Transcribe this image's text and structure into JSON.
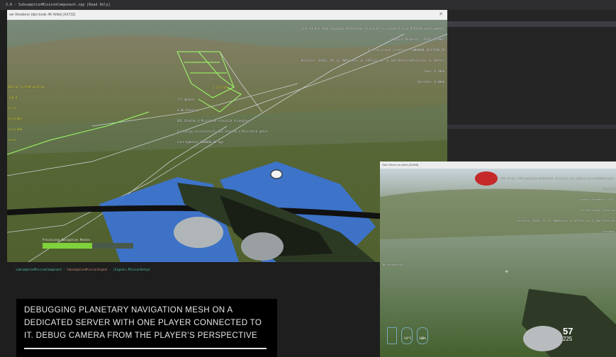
{
  "ide": {
    "title": "2.0 - SubsumptionMissionComponent.cpp [Read Only]",
    "code_line": {
      "a": "subsumptionMissionComponent",
      "b": "SubsumptionMissionSignal",
      "c": "(Signals.MissionSetup)"
    }
  },
  "server_window": {
    "title": "ver Renderer (dpi mode 4K-Wide) [43732]",
    "close_label": "✕",
    "hud_top_right": [
      "Cont AI Dev 7VA4 enginmap PU(Stanton (9.0.0.0) [sc-alpha-3.23.0.9553610 development]",
      "Graphics Renderer : DX11 (7598A)",
      "Current player location : UNKNOWN_LOCATION_ID",
      "Entities: 45656, PS: 0, DWPatches: 0, DFPixelize: 0, Net-DeferredPixelize: 0, Deferr",
      "Zone: 0.20mb",
      "Chardata: 0.00mb"
    ],
    "hud_left": [
      "Nation System working",
      "ing 0",
      "nn 0",
      "ed 0.0ms",
      "ng 0.00%",
      "ed 0"
    ],
    "hud_center_title": "1 Inflate",
    "hud_center": [
      "Tri Update",
      "0.00 Pending",
      "ODC_Stanton_4_Microtech->Invalid triangles",
      "Colliding vicinities(1) ODC_Stanton_4 Microtech patch",
      "Last Updated 1000000.00 ago"
    ],
    "progress_label": "Processing Navigation Meshes",
    "progress_fraction": 0.55
  },
  "client_window": {
    "title": "Star Citizen sc-client [32968]",
    "hud_top_right": [
      "PTS 42-Dev 7VA4 enginmap PU(Stanton (9.0.0.0) [sc-alpha-3.23.0.9553610 devel",
      "FPS 36.8",
      "Graphics Renderer : DX11",
      "Current player location",
      "Entities: 45654, PS: 0, DWPatches: 0, DFPixelize: 0, Net-Deferred",
      "Chardata"
    ],
    "left_label": "No Interaction",
    "ammo_count": "57",
    "ammo_reserve": "225",
    "icons": [
      "player-status-icon",
      "oxygen-icon",
      "health-icon"
    ],
    "status_values": [
      "-14°C",
      "100%"
    ]
  },
  "caption": {
    "text": "Debugging planetary navigation mesh on a dedicated server with one player connected to it. Debug camera from the player’s perspective"
  },
  "colors": {
    "navmesh_green": "#9dff6a",
    "navmesh_blue": "#3b74d8",
    "progress_fill": "#7fd23a",
    "grid_line": "#d8e0e8"
  }
}
